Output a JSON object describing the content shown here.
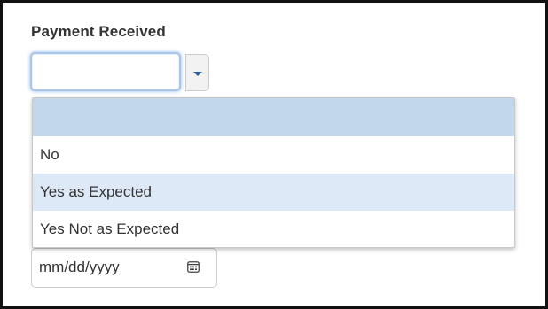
{
  "payment_field": {
    "label": "Payment Received",
    "selected_value": "",
    "toggle_icon": "chevron-down-icon"
  },
  "dropdown": {
    "options": [
      {
        "label": ""
      },
      {
        "label": "No"
      },
      {
        "label": "Yes as Expected"
      },
      {
        "label": "Yes Not as Expected"
      }
    ],
    "highlighted_index": 2,
    "selected_index": 0
  },
  "date_field": {
    "placeholder": "mm/dd/yyyy",
    "icon": "calendar-icon"
  },
  "colors": {
    "selected_option_bg": "#c2d6ec",
    "hover_option_bg": "#dde9f6",
    "focus_ring": "#66a0e6",
    "caret": "#2a5ea8"
  }
}
